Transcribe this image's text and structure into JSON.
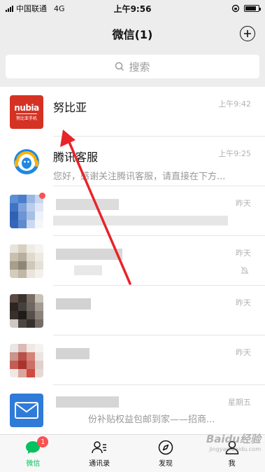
{
  "status_bar": {
    "carrier": "中国联通",
    "network": "4G",
    "time": "上午9:56"
  },
  "header": {
    "title": "微信(1)"
  },
  "search": {
    "placeholder": "搜索"
  },
  "chats": [
    {
      "name": "努比亚",
      "preview": "",
      "time": "上午9:42",
      "avatar_text": "nubia",
      "avatar_sub": "努比亚手机",
      "avatar_color": "#d53224"
    },
    {
      "name": "腾讯客服",
      "preview": "您好，感谢关注腾讯客服，请直接在下方...",
      "time": "上午9:25",
      "avatar_color": "#1e88e5"
    },
    {
      "name": "",
      "preview": "",
      "time": "昨天",
      "unread_dot": true
    },
    {
      "name": "",
      "preview": "",
      "time": "昨天",
      "muted": true
    },
    {
      "name": "",
      "preview": "",
      "time": "昨天"
    },
    {
      "name": "",
      "preview": "",
      "time": "昨天"
    },
    {
      "name": "",
      "preview": "份补贴权益包邮到家——招商...",
      "time": "星期五"
    }
  ],
  "tabs": [
    {
      "label": "微信",
      "badge": "1",
      "active": true,
      "icon": "chat-bubble-icon"
    },
    {
      "label": "通讯录",
      "icon": "contacts-icon"
    },
    {
      "label": "发现",
      "icon": "compass-icon"
    },
    {
      "label": "我",
      "icon": "person-icon"
    }
  ],
  "watermark": {
    "text": "Baidu经验",
    "sub": "jingyan.baidu.com"
  },
  "colors": {
    "accent": "#07c160",
    "badge": "#fa5151",
    "arrow": "#e8232a",
    "background": "#ededed"
  }
}
